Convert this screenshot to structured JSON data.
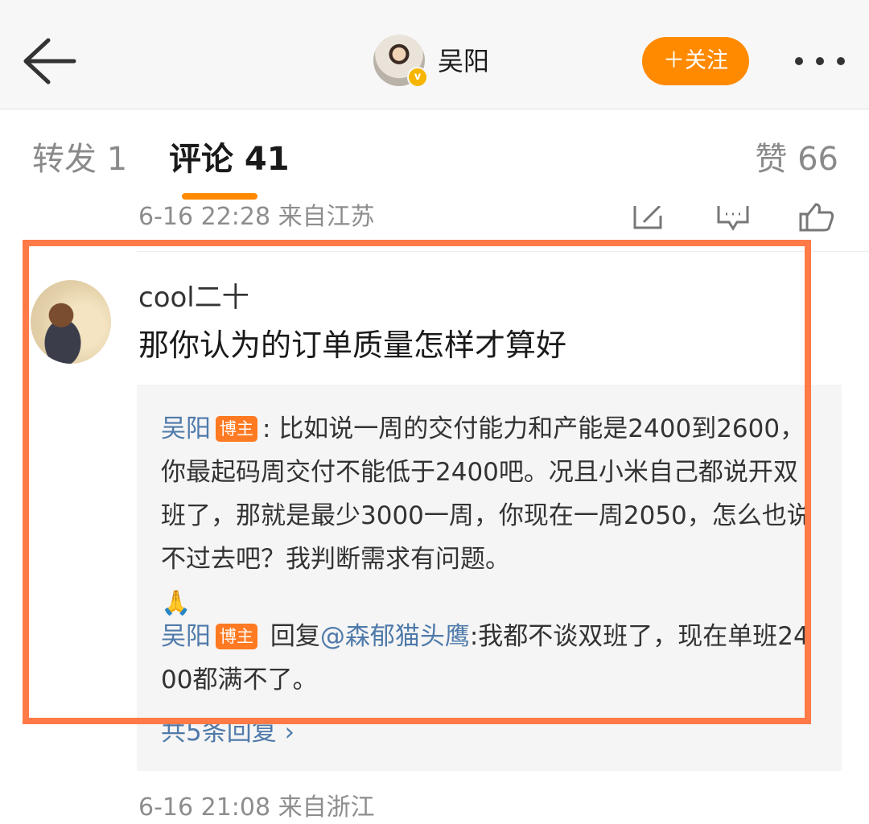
{
  "header": {
    "username": "吴阳",
    "follow_label": "＋关注",
    "verified_mark": "v"
  },
  "tabs": {
    "repost": "转发 1",
    "comment": "评论 41",
    "like": "赞 66"
  },
  "prev_comment": {
    "meta": "6-16 22:28 来自江苏"
  },
  "comment": {
    "author": "cool二十",
    "text": "那你认为的订单质量怎样才算好",
    "replies": [
      {
        "name": "吴阳",
        "badge": "博主",
        "sep": ": ",
        "text": "比如说一周的交付能力和产能是2400到2600，你最起码周交付不能低于2400吧。况且小米自己都说开双班了，那就是最少3000一周，你现在一周2050，怎么也说不过去吧？我判断需求有问题。",
        "emoji": "🙏"
      },
      {
        "name": "吴阳",
        "badge": "博主",
        "prefix": " 回复",
        "mention": "@森郁猫头鹰",
        "text": ":我都不谈双班了，现在单班2400都满不了。"
      }
    ],
    "more_replies": "共5条回复 ›"
  },
  "next_comment": {
    "meta": "6-16 21:08 来自浙江"
  },
  "colors": {
    "accent": "#ff8a00",
    "link": "#4f7aaa",
    "badge": "#ff7a22",
    "highlight": "#ff7a47"
  }
}
